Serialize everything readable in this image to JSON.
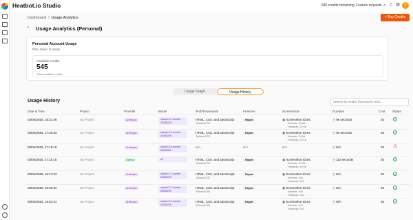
{
  "app": {
    "title": "Heatbot.io Studio"
  },
  "topbar": {
    "credits_remaining": "545 credits remaining",
    "feature_requests": "Feature requests",
    "avatar_initial": "T",
    "external_icon": "↗",
    "theme_icon": "☾",
    "gear_icon": "⚙"
  },
  "breadcrumb": {
    "root": "Dashboard",
    "separator": "/",
    "current": "Usage Analytics"
  },
  "buy_button": {
    "label": "+ Buy Credits"
  },
  "page": {
    "back_icon": "‹",
    "title": "Usage Analytics (Personal)"
  },
  "account_card": {
    "title": "Personal Account Usage",
    "plan": "Plan: Basic (1 Seat)",
    "available_label": "Available Credits",
    "available_value": "545",
    "available_sub": "Total available credits"
  },
  "tabs": [
    {
      "label": "Usage Graph"
    },
    {
      "label": "Usage History"
    }
  ],
  "history": {
    "title": "Usage History",
    "search_placeholder": "Search by model, framework, tech...",
    "columns": [
      "Date & Time",
      "Project",
      "Provider",
      "Model",
      "Tech/Framework",
      "Features",
      "Screenshots",
      "Duration",
      "Cost",
      "Status"
    ],
    "rows": [
      {
        "date": "03/04/2025, 18:21:46",
        "project": "No Project",
        "provider": "Anthropic",
        "provider_type": "anth",
        "model": "claude-3-7-sonnet-20250219",
        "fw": "HTML, CSS, and JavaScript",
        "fw_sub": "TailwindCSS",
        "feature": "Report",
        "shots": "Screenshot Sizes:",
        "shots_w": "Website: 33 kB",
        "shots_h": "Heatmap: 22 kB",
        "duration": "96 seconds",
        "cost": "25",
        "status": "ok"
      },
      {
        "date": "03/04/2025, 17:25:53",
        "project": "No Project",
        "provider": "Anthropic",
        "provider_type": "anth",
        "model": "claude-3-7-sonnet-20250219",
        "fw": "HTML, CSS, and JavaScript",
        "fw_sub": "TailwindCSS",
        "feature": "Report",
        "shots": "Screenshot Sizes:",
        "shots_w": "Website: 20 kB",
        "shots_h": "Heatmap: 22 kB",
        "duration": "93 seconds",
        "cost": "25",
        "status": "ok"
      },
      {
        "date": "03/04/2025, 17:18:18",
        "project": "No Project",
        "provider": "Anthropic",
        "provider_type": "anth",
        "model": "claude-3-5-sonnet-20241022",
        "fw": "N/A",
        "fw_sub": "",
        "feature": "N/A",
        "shots": "N/A",
        "shots_w": "",
        "shots_h": "",
        "duration": "N/A",
        "cost": "25",
        "status": "warn"
      },
      {
        "date": "03/04/2025, 17:15:15",
        "project": "No Project",
        "provider": "Openai",
        "provider_type": "open",
        "model": "o1",
        "fw": "HTML, CSS, and JavaScript",
        "fw_sub": "TailwindCSS",
        "feature": "Report",
        "shots": "Screenshot Sizes:",
        "shots_w": "Website: 37 kB",
        "shots_h": "Heatmap: 40 kB",
        "duration": "110 seconds",
        "cost": "25",
        "status": "ok"
      },
      {
        "date": "03/04/2025, 16:12:23",
        "project": "No Project",
        "provider": "Anthropic",
        "provider_type": "anth",
        "model": "claude-3-7-sonnet-20250219",
        "fw": "HTML, CSS, and JavaScript",
        "fw_sub": "TailwindCSS",
        "feature": "Report",
        "shots": "Screenshot Sizes:",
        "shots_w": "Website: N/A",
        "shots_h": "Heatmap: N/A",
        "duration": "N/A",
        "cost": "25",
        "status": "ok"
      },
      {
        "date": "03/04/2025, 16:02:34",
        "project": "No Project",
        "provider": "Anthropic",
        "provider_type": "anth",
        "model": "claude-3-7-sonnet-20250219",
        "fw": "HTML, CSS, and JavaScript",
        "fw_sub": "TailwindCSS",
        "feature": "Report",
        "shots": "Screenshot Sizes:",
        "shots_w": "Website: N/A",
        "shots_h": "Heatmap: N/A",
        "duration": "N/A",
        "cost": "25",
        "status": "ok"
      },
      {
        "date": "03/04/2025, 15:54:21",
        "project": "No Project",
        "provider": "Anthropic",
        "provider_type": "anth",
        "model": "claude-3-7-sonnet-20250219",
        "fw": "HTML, CSS, and JavaScript",
        "fw_sub": "TailwindCSS",
        "feature": "Report",
        "shots": "Screenshot Sizes:",
        "shots_w": "Website: N/A",
        "shots_h": "Heatmap: N/A",
        "duration": "N/A",
        "cost": "25",
        "status": "ok"
      }
    ]
  },
  "colors": {
    "accent": "#ea580c",
    "success": "#16a34a",
    "danger": "#dc2626"
  }
}
